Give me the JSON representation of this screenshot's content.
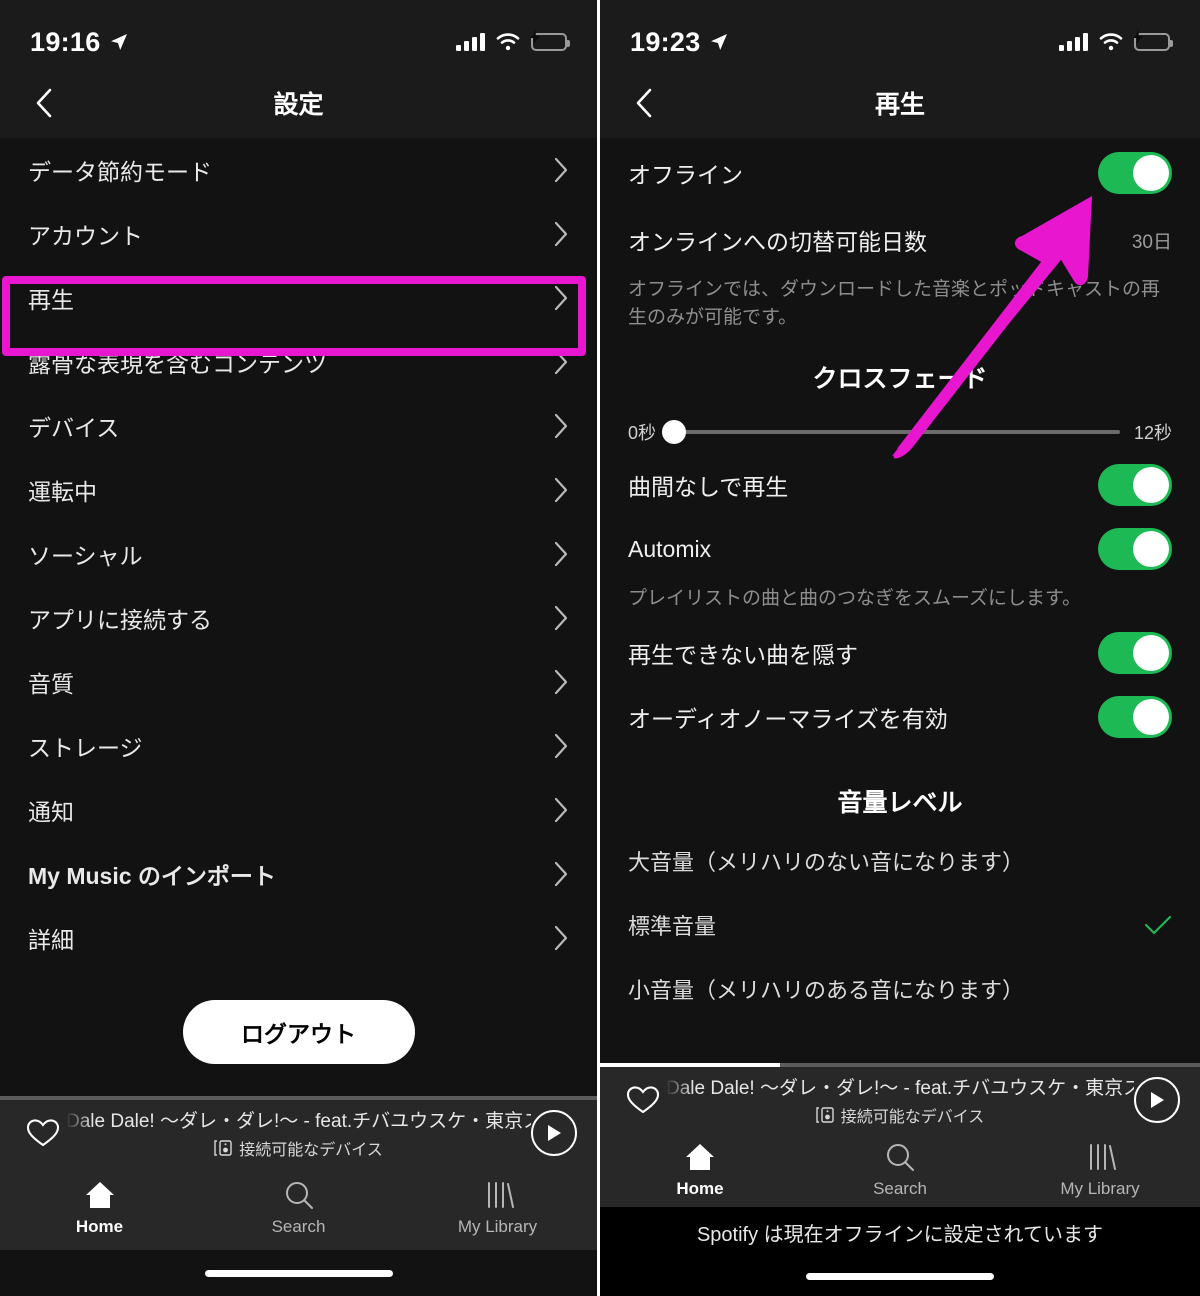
{
  "colors": {
    "accent_magenta": "#e817cf",
    "toggle_green": "#1db954",
    "battery_green": "#30d158",
    "background": "#121212",
    "bar_background": "#282828"
  },
  "left_phone": {
    "status_bar": {
      "time": "19:16",
      "location_icon": "location-arrow-icon",
      "signal_icon": "cellular-signal-icon",
      "wifi_icon": "wifi-icon",
      "battery_icon": "battery-charging-icon"
    },
    "nav": {
      "back_icon": "chevron-left-icon",
      "title": "設定"
    },
    "settings_items": [
      {
        "label": "データ節約モード",
        "chevron": "chevron-right-icon",
        "highlighted": false
      },
      {
        "label": "アカウント",
        "chevron": "chevron-right-icon",
        "highlighted": false
      },
      {
        "label": "再生",
        "chevron": "chevron-right-icon",
        "highlighted": true
      },
      {
        "label": "露骨な表現を含むコンテンツ",
        "chevron": "chevron-right-icon",
        "highlighted": false
      },
      {
        "label": "デバイス",
        "chevron": "chevron-right-icon",
        "highlighted": false
      },
      {
        "label": "運転中",
        "chevron": "chevron-right-icon",
        "highlighted": false
      },
      {
        "label": "ソーシャル",
        "chevron": "chevron-right-icon",
        "highlighted": false
      },
      {
        "label": "アプリに接続する",
        "chevron": "chevron-right-icon",
        "highlighted": false
      },
      {
        "label": "音質",
        "chevron": "chevron-right-icon",
        "highlighted": false
      },
      {
        "label": "ストレージ",
        "chevron": "chevron-right-icon",
        "highlighted": false
      },
      {
        "label": "通知",
        "chevron": "chevron-right-icon",
        "highlighted": false
      },
      {
        "label": "My Music のインポート",
        "chevron": "chevron-right-icon",
        "highlighted": false
      },
      {
        "label": "詳細",
        "chevron": "chevron-right-icon",
        "highlighted": false
      }
    ],
    "logout_label": "ログアウト",
    "now_playing": {
      "progress_percent": 0,
      "heart_icon": "heart-outline-icon",
      "track_title": "Dale Dale! 〜ダレ・ダレ!〜 - feat.チバユウスケ・東京スカパラ",
      "device_icon": "connect-device-icon",
      "device_text": "接続可能なデバイス",
      "play_icon": "play-icon"
    },
    "tabs": [
      {
        "label": "Home",
        "icon": "home-icon",
        "active": true
      },
      {
        "label": "Search",
        "icon": "search-icon",
        "active": false
      },
      {
        "label": "My Library",
        "icon": "library-icon",
        "active": false
      }
    ]
  },
  "right_phone": {
    "status_bar": {
      "time": "19:23",
      "location_icon": "location-arrow-icon",
      "signal_icon": "cellular-signal-icon",
      "wifi_icon": "wifi-icon",
      "battery_icon": "battery-charging-icon"
    },
    "nav": {
      "back_icon": "chevron-left-icon",
      "title": "再生"
    },
    "offline_row": {
      "label": "オフライン",
      "toggle_on": true
    },
    "days_row": {
      "label": "オンラインへの切替可能日数",
      "value": "30日"
    },
    "offline_description": "オフラインでは、ダウンロードした音楽とポッドキャストの再生のみが可能です。",
    "crossfade": {
      "title": "クロスフェード",
      "min_label": "0秒",
      "max_label": "12秒",
      "value": 0,
      "min": 0,
      "max": 12
    },
    "toggle_rows": [
      {
        "label": "曲間なしで再生",
        "toggle_on": true
      },
      {
        "label": "Automix",
        "toggle_on": true
      }
    ],
    "automix_description": "プレイリストの曲と曲のつなぎをスムーズにします。",
    "toggle_rows2": [
      {
        "label": "再生できない曲を隠す",
        "toggle_on": true
      },
      {
        "label": "オーディオノーマライズを有効",
        "toggle_on": true
      }
    ],
    "volume": {
      "title": "音量レベル",
      "options": [
        {
          "label": "大音量（メリハリのない音になります）",
          "selected": false
        },
        {
          "label": "標準音量",
          "selected": true
        },
        {
          "label": "小音量（メリハリのある音になります）",
          "selected": false
        }
      ],
      "check_icon": "check-icon"
    },
    "now_playing": {
      "progress_percent": 30,
      "heart_icon": "heart-outline-icon",
      "track_title": "Dale Dale! 〜ダレ・ダレ!〜 - feat.チバユウスケ・東京スカパラ",
      "device_icon": "connect-device-icon",
      "device_text": "接続可能なデバイス",
      "play_icon": "play-icon"
    },
    "tabs": [
      {
        "label": "Home",
        "icon": "home-icon",
        "active": true
      },
      {
        "label": "Search",
        "icon": "search-icon",
        "active": false
      },
      {
        "label": "My Library",
        "icon": "library-icon",
        "active": false
      }
    ],
    "offline_banner": "Spotify は現在オフラインに設定されています"
  },
  "annotation": {
    "arrow_icon": "magenta-arrow-pointing-to-offline-toggle",
    "highlight_box_icon": "magenta-highlight-box-around-playback-item"
  }
}
